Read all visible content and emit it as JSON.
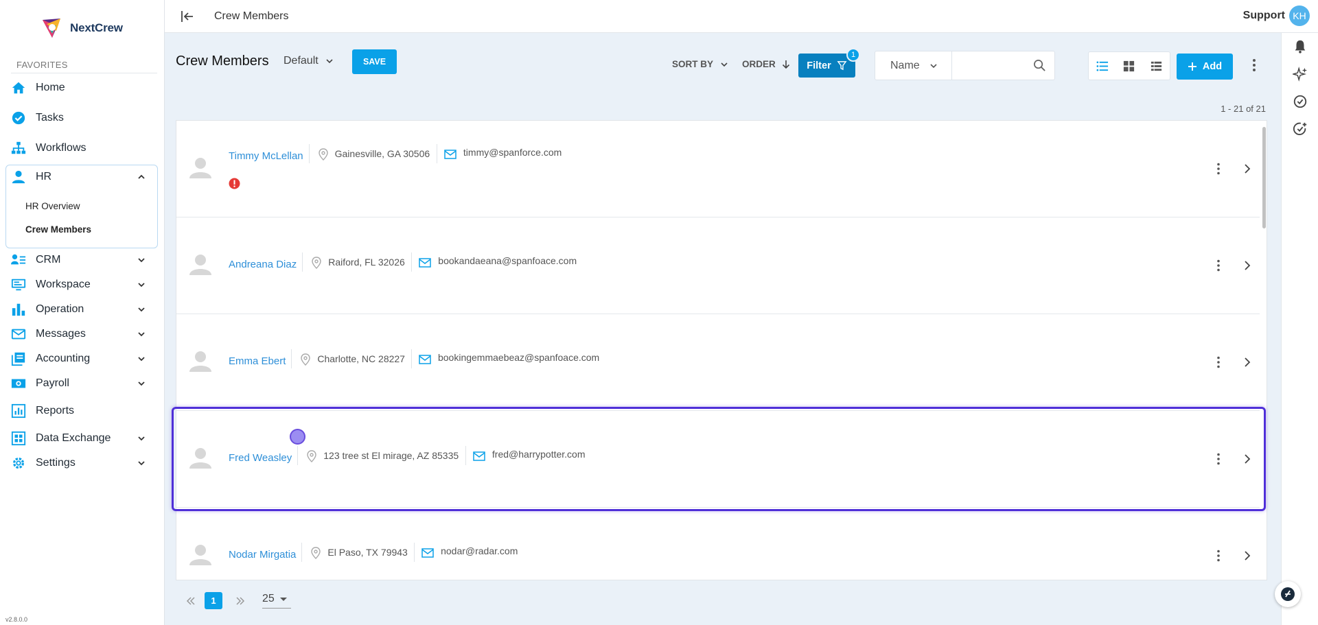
{
  "app": {
    "name": "NextCrew",
    "version": "v2.8.0.0"
  },
  "sidebar": {
    "favorites_label": "FAVORITES",
    "items": [
      {
        "label": "Home",
        "icon": "home-icon"
      },
      {
        "label": "Tasks",
        "icon": "check-circle-icon"
      },
      {
        "label": "Workflows",
        "icon": "sitemap-icon"
      },
      {
        "label": "HR",
        "icon": "person-icon",
        "expanded": true
      },
      {
        "label": "CRM",
        "icon": "contacts-icon"
      },
      {
        "label": "Workspace",
        "icon": "monitor-icon"
      },
      {
        "label": "Operation",
        "icon": "bar-chart-icon"
      },
      {
        "label": "Messages",
        "icon": "mail-icon"
      },
      {
        "label": "Accounting",
        "icon": "ledger-icon"
      },
      {
        "label": "Payroll",
        "icon": "money-icon"
      },
      {
        "label": "Reports",
        "icon": "report-icon"
      },
      {
        "label": "Data Exchange",
        "icon": "grid-icon"
      },
      {
        "label": "Settings",
        "icon": "gear-icon"
      }
    ],
    "hr_subitems": [
      {
        "label": "HR Overview"
      },
      {
        "label": "Crew Members",
        "active": true
      }
    ]
  },
  "topbar": {
    "title": "Crew Members",
    "support": "Support",
    "avatar_initials": "KH"
  },
  "toolbar": {
    "page_title": "Crew Members",
    "view_name": "Default",
    "save_label": "SAVE",
    "sort_by_label": "SORT BY",
    "order_label": "ORDER",
    "filter_label": "Filter",
    "filter_count": "1",
    "search_field": "Name",
    "search_value": "",
    "add_label": "Add"
  },
  "range_text": "1 - 21 of 21",
  "crew_members": [
    {
      "name": "Timmy McLellan",
      "location": "Gainesville, GA 30506",
      "email": "timmy@spanforce.com",
      "warning": true
    },
    {
      "name": "Andreana Diaz",
      "location": "Raiford, FL 32026",
      "email": "bookandaeana@spanfoace.com",
      "warning": false
    },
    {
      "name": "Emma Ebert",
      "location": "Charlotte, NC 28227",
      "email": "bookingemmaebeaz@spanfoace.com",
      "warning": false
    },
    {
      "name": "Fred Weasley",
      "location": "123 tree st El mirage, AZ 85335",
      "email": "fred@harrypotter.com",
      "warning": false
    },
    {
      "name": "Nodar Mirgatia",
      "location": "El Paso, TX 79943",
      "email": "nodar@radar.com",
      "warning": false
    }
  ],
  "pagination": {
    "current_page": "1",
    "page_size": "25"
  },
  "colors": {
    "accent": "#0aa1e8",
    "filter": "#0880bf",
    "highlight": "#4f2fd8",
    "link": "#2e8fd8",
    "warning": "#e53935"
  }
}
